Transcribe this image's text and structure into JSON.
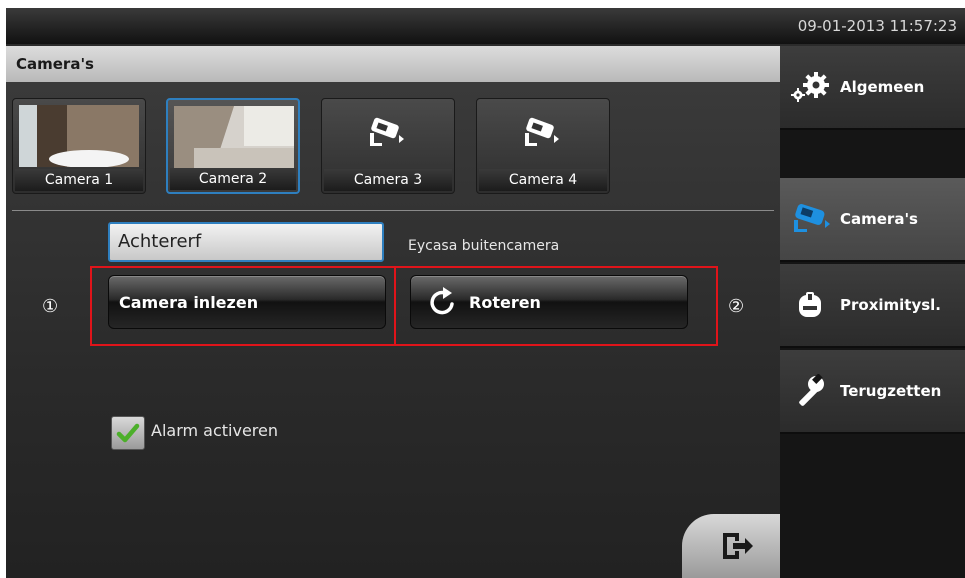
{
  "statusbar": {
    "datetime": "09-01-2013 11:57:23"
  },
  "header": {
    "title": "Camera's"
  },
  "cameras": [
    {
      "label": "Camera 1",
      "preview": "photo",
      "selected": false
    },
    {
      "label": "Camera 2",
      "preview": "photo",
      "selected": true
    },
    {
      "label": "Camera 3",
      "preview": "camera-icon",
      "selected": false
    },
    {
      "label": "Camera 4",
      "preview": "camera-icon",
      "selected": false
    }
  ],
  "camera_name": {
    "value": "Achtererf"
  },
  "camera_description": "Eycasa buitencamera",
  "markers": {
    "first": "①",
    "second": "②"
  },
  "buttons": {
    "read_camera": "Camera inlezen",
    "rotate": "Roteren",
    "rotate_icon": "rotate-icon",
    "exit_icon": "exit-icon"
  },
  "alarm": {
    "label": "Alarm activeren",
    "checked": true
  },
  "sidebar": {
    "items": [
      {
        "label": "Algemeen",
        "icon": "gears-icon",
        "active": false
      },
      {
        "label": "Camera's",
        "icon": "camera-icon",
        "active": true
      },
      {
        "label": "Proximitysl.",
        "icon": "proximity-icon",
        "active": false
      },
      {
        "label": "Terugzetten",
        "icon": "wrench-icon",
        "active": false
      }
    ]
  },
  "colors": {
    "accent": "#2e7fbf",
    "highlight": "#e0141a",
    "check": "#4caf2a"
  }
}
